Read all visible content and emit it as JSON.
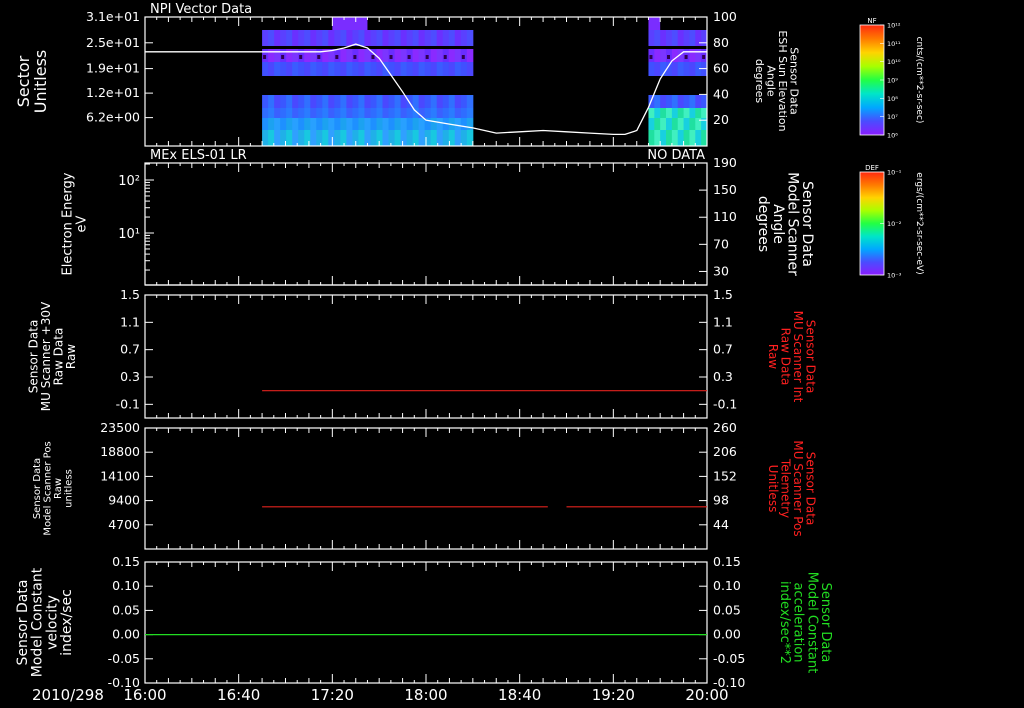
{
  "x_tick_labels": [
    "16:00",
    "16:40",
    "17:20",
    "18:00",
    "18:40",
    "19:20",
    "20:00"
  ],
  "date_label": "2010/298",
  "colors": {
    "background": "#000000",
    "foreground": "#ffffff",
    "red_trace": "#e0231e",
    "green_trace": "#22dd22",
    "red_label": "#ff2020",
    "green_label": "#22dd22"
  },
  "colorbars": [
    {
      "title": "NF",
      "unit": "cnts/(cm**2-sr-sec)",
      "ticks": [
        "10¹²",
        "10¹¹",
        "10¹⁰",
        "10⁹",
        "10⁸",
        "10⁷",
        "10⁶"
      ]
    },
    {
      "title": "DEF",
      "unit": "ergs/(cm**2-sr-sec-eV)",
      "ticks": [
        "10⁻¹",
        "10⁻²",
        "10⁻³"
      ]
    }
  ],
  "chart_data": [
    {
      "type": "heatmap",
      "title": "NPI Vector Data",
      "ylabel": [
        "Sector",
        "Unitless"
      ],
      "y_ticks": [
        "3.1e+01",
        "2.5e+01",
        "1.9e+01",
        "1.2e+01",
        "6.2e+00"
      ],
      "right_label": [
        "Sensor Data",
        "ESH Sun Elevation",
        "Angle",
        "degrees"
      ],
      "right_ticks": [
        "100",
        "80",
        "60",
        "40",
        "20"
      ],
      "right_ylim": [
        0,
        100
      ],
      "x_range": [
        "16:00",
        "20:00"
      ],
      "data_segments": [
        {
          "start": "16:50",
          "end": "18:20"
        },
        {
          "start": "19:35",
          "end": "20:00"
        }
      ],
      "overlay_line": {
        "name": "ESH Sun Elevation Angle",
        "x": [
          "16:00",
          "17:15",
          "17:20",
          "17:25",
          "17:30",
          "17:35",
          "17:40",
          "17:45",
          "17:50",
          "17:55",
          "18:00",
          "18:10",
          "18:20",
          "18:30",
          "18:40",
          "18:50",
          "19:00",
          "19:10",
          "19:20",
          "19:25",
          "19:30",
          "19:35",
          "19:40",
          "19:45",
          "19:50",
          "20:00"
        ],
        "y": [
          73,
          73,
          74,
          76,
          79,
          76,
          68,
          55,
          42,
          28,
          20,
          17,
          14,
          10,
          11,
          12,
          11,
          10,
          9,
          9,
          12,
          30,
          52,
          66,
          73,
          73
        ]
      }
    },
    {
      "type": "line",
      "title": "MEx ELS-01 LR",
      "status": "NO DATA",
      "ylabel": [
        "Electron Energy",
        "eV"
      ],
      "y_ticks": [
        "10²",
        "10¹"
      ],
      "right_label": [
        "Sensor Data",
        "Model Scanner",
        "Angle",
        "degrees"
      ],
      "right_ticks": [
        "190",
        "150",
        "110",
        "70",
        "30"
      ],
      "right_ylim": [
        10,
        190
      ],
      "series": [
        {
          "x": [
            "16:00",
            "20:00"
          ],
          "y": [
            10,
            10
          ]
        }
      ]
    },
    {
      "type": "line",
      "ylabel": [
        "Sensor Data",
        "MU Scanner +30V",
        "Raw Data",
        "Raw"
      ],
      "y_ticks": [
        "1.5",
        "1.1",
        "0.7",
        "0.3",
        "-0.1"
      ],
      "ylim": [
        -0.3,
        1.5
      ],
      "right_label": [
        "Sensor Data",
        "MU Scanner Int",
        "Raw Data",
        "Raw"
      ],
      "right_ticks": [
        "1.5",
        "1.1",
        "0.7",
        "0.3",
        "-0.1"
      ],
      "series": [
        {
          "color": "red",
          "x": [
            "16:50",
            "20:00"
          ],
          "y": [
            0.1,
            0.1
          ]
        }
      ]
    },
    {
      "type": "line",
      "ylabel": [
        "Sensor Data",
        "Model Scanner Pos",
        "Raw",
        "unitless"
      ],
      "y_ticks": [
        "23500",
        "18800",
        "14100",
        "9400",
        "4700"
      ],
      "ylim": [
        0,
        23500
      ],
      "right_label": [
        "Sensor Data",
        "MU Scanner Pos",
        "Telemetry",
        "Unitless"
      ],
      "right_ticks": [
        "260",
        "206",
        "152",
        "98",
        "44"
      ],
      "series": [
        {
          "color": "red",
          "x": [
            "16:50",
            "18:52"
          ],
          "y": [
            8200,
            8200
          ]
        },
        {
          "color": "red",
          "x": [
            "19:00",
            "20:00"
          ],
          "y": [
            8200,
            8200
          ]
        }
      ]
    },
    {
      "type": "line",
      "ylabel": [
        "Sensor Data",
        "Model Constant",
        "velocity",
        "index/sec"
      ],
      "y_ticks": [
        "0.15",
        "0.10",
        "0.05",
        "0.00",
        "-0.05",
        "-0.10"
      ],
      "ylim": [
        -0.1,
        0.15
      ],
      "right_label": [
        "Sensor Data",
        "Model Constant",
        "acceleration",
        "index/sec**2"
      ],
      "right_ticks": [
        "0.15",
        "0.10",
        "0.05",
        "0.00",
        "-0.05",
        "-0.10"
      ],
      "series": [
        {
          "color": "green",
          "x": [
            "16:00",
            "20:00"
          ],
          "y": [
            0,
            0
          ]
        }
      ]
    }
  ]
}
